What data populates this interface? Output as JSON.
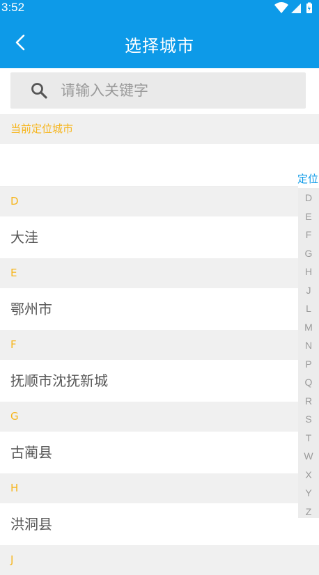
{
  "status_bar": {
    "time": "3:52"
  },
  "header": {
    "title": "选择城市"
  },
  "search": {
    "placeholder": "请输入关键字"
  },
  "location": {
    "header": "当前定位城市"
  },
  "sections": [
    {
      "letter": "D",
      "cities": [
        "大洼"
      ]
    },
    {
      "letter": "E",
      "cities": [
        "鄂州市"
      ]
    },
    {
      "letter": "F",
      "cities": [
        "抚顺市沈抚新城"
      ]
    },
    {
      "letter": "G",
      "cities": [
        "古蔺县"
      ]
    },
    {
      "letter": "H",
      "cities": [
        "洪洞县"
      ]
    },
    {
      "letter": "J",
      "cities": []
    }
  ],
  "index_bar": {
    "location_label": "定位",
    "letters": [
      "D",
      "E",
      "F",
      "G",
      "H",
      "J",
      "L",
      "M",
      "N",
      "P",
      "Q",
      "R",
      "S",
      "T",
      "W",
      "X",
      "Y",
      "Z"
    ]
  },
  "colors": {
    "primary": "#0d9ae8",
    "section_text": "#f6b51c",
    "section_bg": "#f0f0f0"
  }
}
